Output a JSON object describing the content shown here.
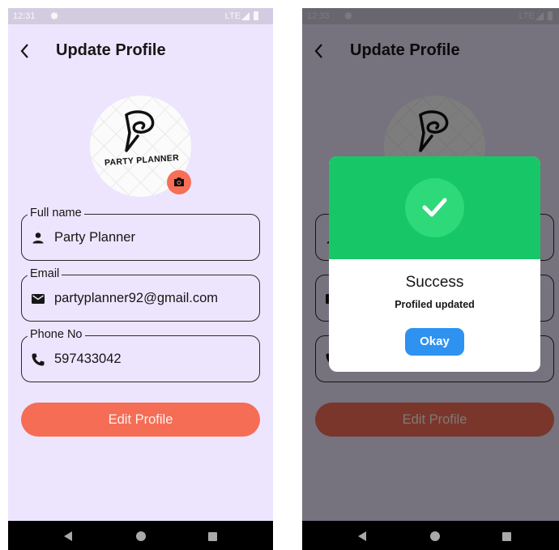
{
  "colors": {
    "background": "#ede5fd",
    "accent": "#f56d55",
    "success_header": "#17c667",
    "okay_button": "#2e92f0",
    "text": "#161616"
  },
  "screens": [
    {
      "status_bar": {
        "time": "12:31",
        "network": "LTE",
        "icons": [
          "gear-icon",
          "signal-icon",
          "battery-icon"
        ]
      },
      "app_bar": {
        "back_icon": "chevron-left-icon",
        "title": "Update Profile"
      },
      "avatar": {
        "logo_text": "PARTY PLANNER",
        "camera_icon": "camera-icon"
      },
      "fields": [
        {
          "label": "Full name",
          "icon": "person-icon",
          "value": "Party Planner"
        },
        {
          "label": "Email",
          "icon": "mail-icon",
          "value": "partyplanner92@gmail.com"
        },
        {
          "label": "Phone No",
          "icon": "phone-icon",
          "value": "597433042"
        }
      ],
      "primary_button": "Edit Profile",
      "nav_bar": [
        "back-triangle-icon",
        "home-circle-icon",
        "recents-square-icon"
      ]
    },
    {
      "status_bar": {
        "time": "12:33",
        "network": "LTE",
        "icons": [
          "gear-icon",
          "signal-icon",
          "battery-icon"
        ]
      },
      "app_bar": {
        "back_icon": "chevron-left-icon",
        "title": "Update Profile"
      },
      "primary_button": "Edit Profile",
      "dialog": {
        "icon": "checkmark-icon",
        "title": "Success",
        "message": "Profiled updated",
        "button": "Okay"
      },
      "nav_bar": [
        "back-triangle-icon",
        "home-circle-icon",
        "recents-square-icon"
      ]
    }
  ]
}
